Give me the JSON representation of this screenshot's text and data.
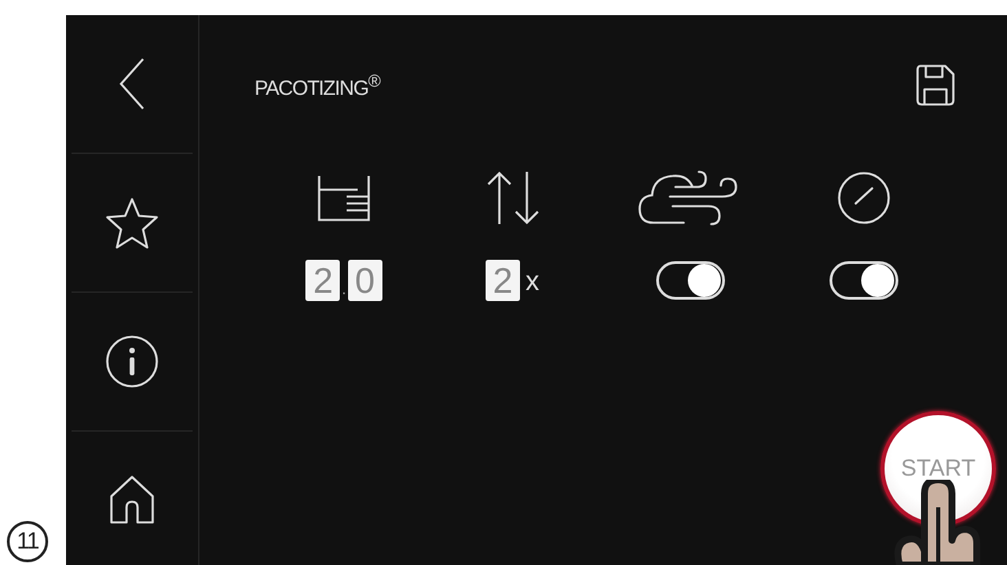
{
  "step_label": "11",
  "header": {
    "title": "PACOTIZING$^{®}$"
  },
  "settings": [
    {
      "kind": "digits",
      "digits": [
        "2",
        "0"
      ],
      "separator": "."
    },
    {
      "kind": "digits",
      "digits": [
        "2"
      ],
      "suffix": "x"
    },
    {
      "kind": "toggle",
      "on": true
    },
    {
      "kind": "toggle",
      "on": true
    }
  ],
  "start_button": {
    "label": "START"
  }
}
